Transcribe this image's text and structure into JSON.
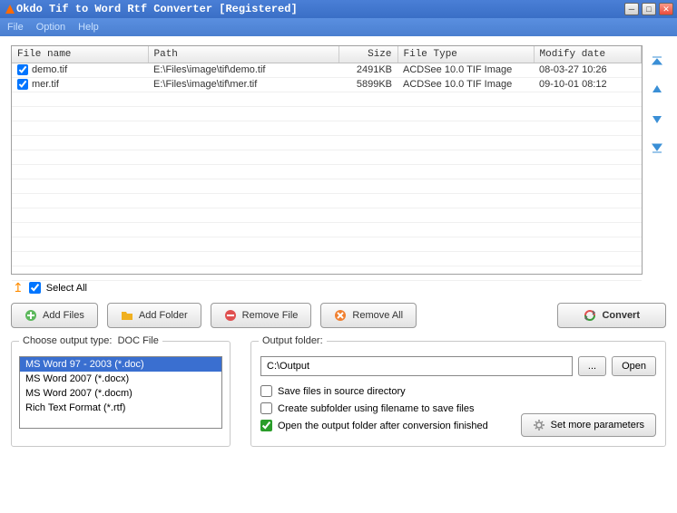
{
  "window": {
    "title": "Okdo Tif to Word Rtf Converter [Registered]"
  },
  "menu": {
    "file": "File",
    "option": "Option",
    "help": "Help"
  },
  "columns": {
    "filename": "File name",
    "path": "Path",
    "size": "Size",
    "filetype": "File Type",
    "modify": "Modify date"
  },
  "rows": [
    {
      "checked": true,
      "name": "demo.tif",
      "path": "E:\\Files\\image\\tif\\demo.tif",
      "size": "2491KB",
      "type": "ACDSee 10.0 TIF Image",
      "date": "08-03-27 10:26"
    },
    {
      "checked": true,
      "name": "mer.tif",
      "path": "E:\\Files\\image\\tif\\mer.tif",
      "size": "5899KB",
      "type": "ACDSee 10.0 TIF Image",
      "date": "09-10-01 08:12"
    }
  ],
  "selectall": {
    "label": "Select All",
    "checked": true
  },
  "buttons": {
    "addfiles": "Add Files",
    "addfolder": "Add Folder",
    "removefile": "Remove File",
    "removeall": "Remove All",
    "convert": "Convert"
  },
  "outputtype": {
    "label_prefix": "Choose output type:",
    "current": "DOC File",
    "options": [
      "MS Word 97 - 2003 (*.doc)",
      "MS Word 2007 (*.docx)",
      "MS Word 2007 (*.docm)",
      "Rich Text Format (*.rtf)"
    ],
    "selected_index": 0
  },
  "outputfolder": {
    "label": "Output folder:",
    "value": "C:\\Output",
    "browse": "...",
    "open": "Open"
  },
  "checks": {
    "save_src": {
      "label": "Save files in source directory",
      "checked": false
    },
    "subfolder": {
      "label": "Create subfolder using filename to save files",
      "checked": false
    },
    "openafter": {
      "label": "Open the output folder after conversion finished",
      "checked": true
    }
  },
  "moreparams": "Set more parameters"
}
